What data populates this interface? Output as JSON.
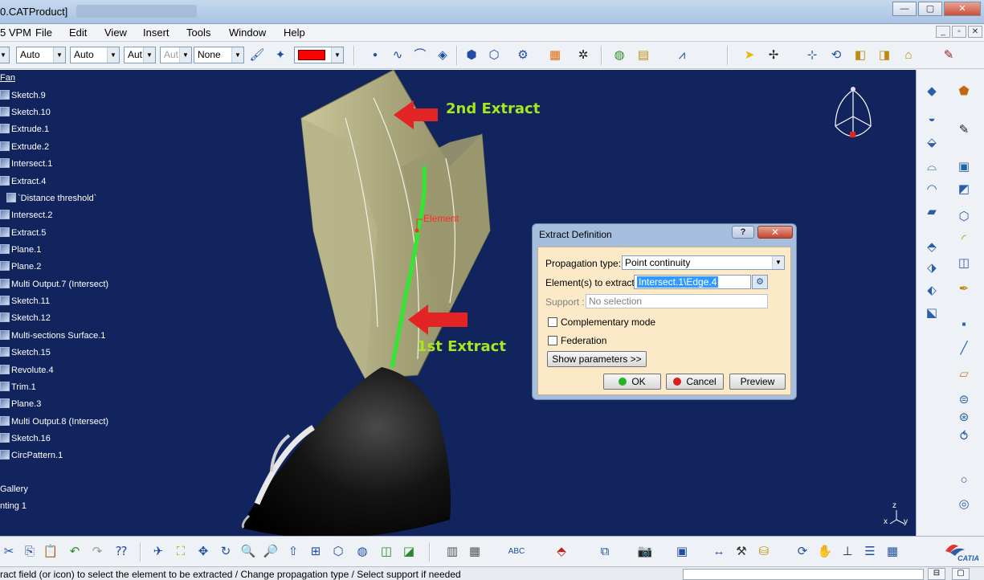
{
  "window": {
    "title": "0.CATProduct]"
  },
  "menu": [
    "5 VPM",
    "File",
    "Edit",
    "View",
    "Insert",
    "Tools",
    "Window",
    "Help"
  ],
  "toolbar": {
    "combo1": "Auto",
    "combo2": "Auto",
    "combo3": "Aut",
    "combo4": "Aut",
    "combo5": "None",
    "color": "#ff0000"
  },
  "tree": [
    "Fan",
    "Sketch.9",
    "Sketch.10",
    "Extrude.1",
    "Extrude.2",
    "Intersect.1",
    "Extract.4",
    "`Distance threshold`",
    "Intersect.2",
    "Extract.5",
    "Plane.1",
    "Plane.2",
    "Multi Output.7 (Intersect)",
    "Sketch.11",
    "Sketch.12",
    "Multi-sections Surface.1",
    "Sketch.15",
    "Revolute.4",
    "Trim.1",
    "Plane.3",
    "Multi Output.8 (Intersect)",
    "Sketch.16",
    "CircPattern.1",
    "Gallery",
    "nting 1"
  ],
  "annotations": {
    "second": "2nd Extract",
    "first": "1st Extract",
    "element": "Element"
  },
  "dialog": {
    "title": "Extract Definition",
    "help": "?",
    "close": "✕",
    "propagation_label": "Propagation type:",
    "propagation_value": "Point continuity",
    "elements_label": "Element(s) to extract:",
    "elements_value": "Intersect.1\\Edge.4",
    "support_label": "Support :",
    "support_value": "No selection",
    "complementary_label": "Complementary mode",
    "federation_label": "Federation",
    "show_params": "Show parameters >>",
    "ok": "OK",
    "cancel": "Cancel",
    "preview": "Preview"
  },
  "compass": {
    "x": "x",
    "y": "y",
    "z": "z"
  },
  "status": {
    "message": "ract field (or icon) to select the element to be extracted / Change propagation type / Select support if needed"
  },
  "logo": "CATIA"
}
